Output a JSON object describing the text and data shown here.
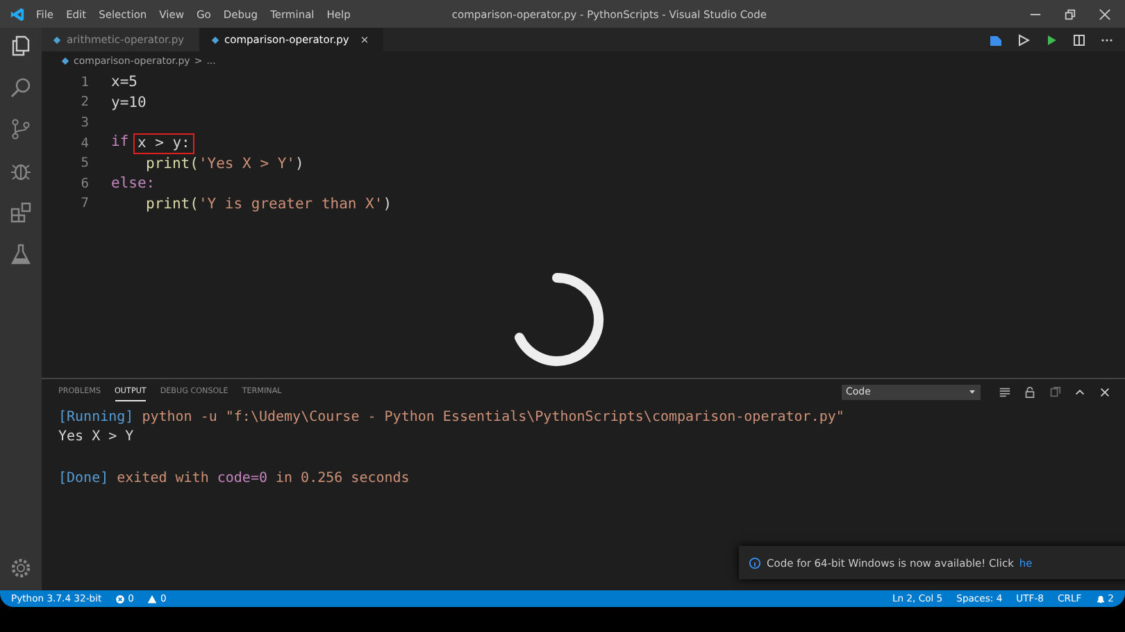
{
  "window": {
    "title": "comparison-operator.py - PythonScripts - Visual Studio Code"
  },
  "menu": [
    "File",
    "Edit",
    "Selection",
    "View",
    "Go",
    "Debug",
    "Terminal",
    "Help"
  ],
  "tabs": [
    {
      "label": "arithmetic-operator.py",
      "selected": false
    },
    {
      "label": "comparison-operator.py",
      "selected": true,
      "close": "×"
    }
  ],
  "breadcrumb": [
    "comparison-operator.py",
    ">",
    "..."
  ],
  "editor": {
    "lines": [
      {
        "number": "1",
        "indent": false,
        "tokens": [
          {
            "text": "x=5",
            "kind": "var"
          }
        ]
      },
      {
        "number": "2",
        "indent": false,
        "tokens": [
          {
            "text": "y=10",
            "kind": "var"
          }
        ]
      },
      {
        "number": "3"
      },
      {
        "number": "4",
        "indent": false,
        "tokens": [
          {
            "text": "if",
            "kind": "keyword"
          },
          {
            "text": "x > y:",
            "kind": "plain",
            "boxed": true
          }
        ]
      },
      {
        "number": "5",
        "indent": true,
        "tokens": [
          {
            "text": "print(",
            "kind": "func"
          },
          {
            "text": "'Yes X > Y'",
            "kind": "string"
          },
          {
            "text": ")",
            "kind": "plain"
          }
        ]
      },
      {
        "number": "6",
        "indent": false,
        "tokens": [
          {
            "text": "else:",
            "kind": "keyword"
          }
        ]
      },
      {
        "number": "7",
        "indent": true,
        "tokens": [
          {
            "text": "print(",
            "kind": "func"
          },
          {
            "text": "'Y is greater than X'",
            "kind": "string"
          },
          {
            "text": ")",
            "kind": "plain"
          }
        ]
      }
    ]
  },
  "panel": {
    "tabs": [
      {
        "label": "PROBLEMS",
        "selected": false
      },
      {
        "label": "OUTPUT",
        "selected": true
      },
      {
        "label": "DEBUG CONSOLE",
        "selected": false
      },
      {
        "label": "TERMINAL",
        "selected": false
      }
    ],
    "channel": "Code",
    "output": [
      {
        "spaced": false,
        "tokens": [
          {
            "text": "[Running]",
            "kind": "tag"
          },
          {
            "text": "python -u \"f:\\Udemy\\Course - Python Essentials\\PythonScripts\\comparison-operator.py\"",
            "kind": "string"
          }
        ]
      },
      {
        "spaced": false,
        "tokens": [
          {
            "text": "Yes X > Y",
            "kind": "plain"
          }
        ]
      },
      {
        "spaced": true,
        "tokens": [
          {
            "text": "[Done]",
            "kind": "tag"
          },
          {
            "text": "exited with",
            "kind": "string"
          },
          {
            "text": "code=0",
            "kind": "code"
          },
          {
            "text": "in 0.256 seconds",
            "kind": "string"
          }
        ]
      }
    ]
  },
  "notification": {
    "text": "Code for 64-bit Windows is now available! Click",
    "link": "he"
  },
  "status_bar": {
    "left": [
      {
        "text": "Python 3.7.4 32-bit",
        "kind": "text"
      },
      {
        "text": "0",
        "kind": "errors"
      },
      {
        "text": "0",
        "kind": "warnings"
      }
    ],
    "right": [
      {
        "text": "Ln 2, Col 5",
        "kind": "text"
      },
      {
        "text": "Spaces: 4",
        "kind": "text"
      },
      {
        "text": "UTF-8",
        "kind": "text"
      },
      {
        "text": "CRLF",
        "kind": "text"
      },
      {
        "text": "2",
        "kind": "bell"
      }
    ]
  }
}
